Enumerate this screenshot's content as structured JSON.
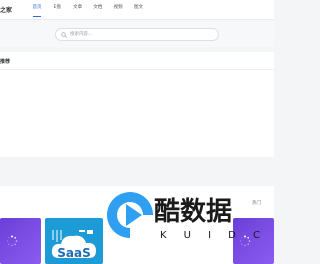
{
  "header": {
    "logo_text": "之家",
    "nav": [
      "首页",
      "E盘",
      "文章",
      "文档",
      "视频",
      "图文"
    ],
    "active_index": 0
  },
  "search": {
    "placeholder": "搜索内容..."
  },
  "panel": {
    "title": "推荐"
  },
  "strip": {
    "hot_label": "热门",
    "saas_label": "SaaS"
  },
  "watermark": {
    "title": "酷数据",
    "letters": [
      "K",
      "U",
      "I",
      "D",
      "C"
    ]
  },
  "colors": {
    "accent": "#2e6bdf",
    "saas_bg": "#1d9bd7",
    "card_purple": "#7a4fe6"
  }
}
